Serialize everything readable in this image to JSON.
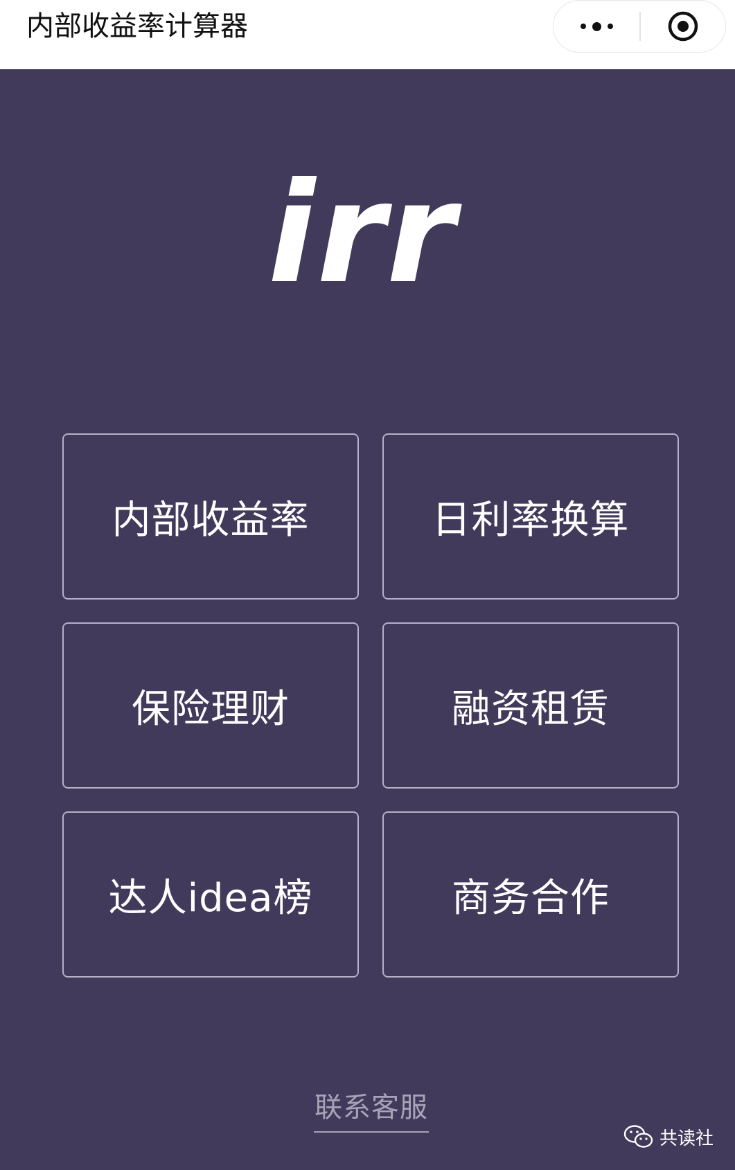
{
  "nav_bar": {
    "title": "内部收益率计算器",
    "more_icon": "more-dots-icon",
    "close_icon": "target-circle-icon"
  },
  "logo": {
    "text": "irr"
  },
  "menu": {
    "items": [
      {
        "label": "内部收益率"
      },
      {
        "label": "日利率换算"
      },
      {
        "label": "保险理财"
      },
      {
        "label": "融资租赁"
      },
      {
        "label": "达人idea榜"
      },
      {
        "label": "商务合作"
      }
    ]
  },
  "footer": {
    "contact_label": "联系客服"
  },
  "watermark": {
    "text": "共读社",
    "icon": "wechat-icon"
  },
  "colors": {
    "background": "#413a5a",
    "card_border": "#b6b0c8",
    "muted_text": "#a8a3b8",
    "nav_background": "#ffffff"
  }
}
